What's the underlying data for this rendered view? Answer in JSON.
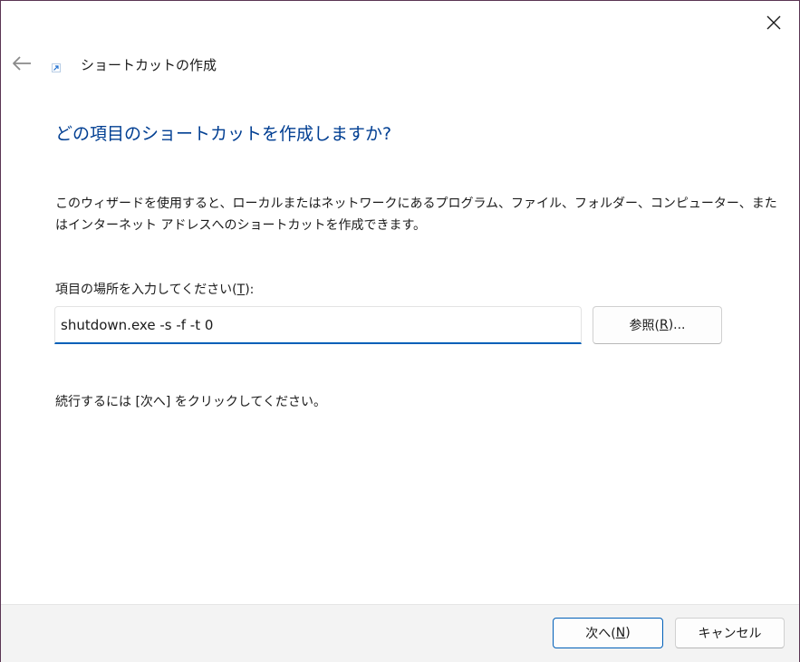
{
  "window": {
    "title": "ショートカットの作成",
    "close_icon": "close-icon",
    "back_icon": "back-arrow-icon",
    "shortcut_icon": "shortcut-arrow-icon"
  },
  "main": {
    "heading": "どの項目のショートカットを作成しますか?",
    "description_line1": "このウィザードを使用すると、ローカルまたはネットワークにあるプログラム、ファイル、フォルダー、コンピューター、また",
    "description_line2": "はインターネット アドレスへのショートカットを作成できます。",
    "field_label_prefix": "項目の場所を入力してください(",
    "field_label_mnemonic": "T",
    "field_label_suffix": "):",
    "location_value": "shutdown.exe -s -f -t 0",
    "browse_prefix": "参照(",
    "browse_mnemonic": "R",
    "browse_suffix": ")...",
    "hint": "続行するには [次へ] をクリックしてください。"
  },
  "footer": {
    "next_prefix": "次へ(",
    "next_mnemonic": "N",
    "next_suffix": ")",
    "cancel_label": "キャンセル"
  },
  "colors": {
    "heading": "#003e92",
    "accent": "#005fb8",
    "footer_bg": "#f3f3f3"
  }
}
